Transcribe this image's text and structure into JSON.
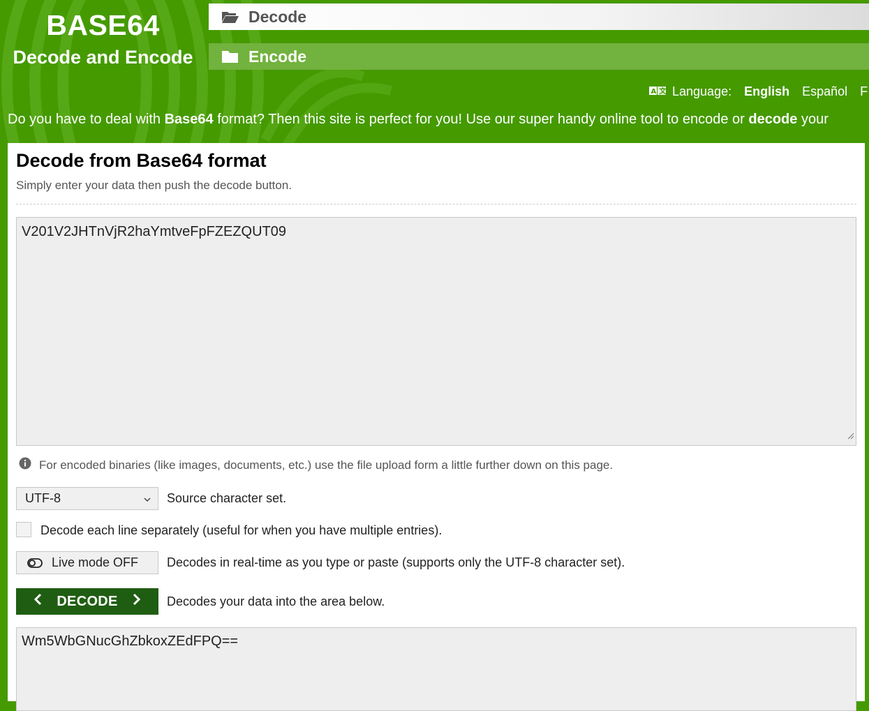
{
  "logo": {
    "title": "BASE64",
    "subtitle": "Decode and Encode"
  },
  "nav": {
    "decode_label": "Decode",
    "encode_label": "Encode"
  },
  "language": {
    "label": "Language:",
    "current": "English",
    "options": [
      "Español",
      "F"
    ]
  },
  "tagline": {
    "part1": "Do you have to deal with ",
    "bold1": "Base64",
    "part2": " format? Then this site is perfect for you! Use our super handy online tool to encode or ",
    "bold2": "decode",
    "part3": " your"
  },
  "main": {
    "title": "Decode from Base64 format",
    "subtitle": "Simply enter your data then push the decode button.",
    "input_value": "V201V2JHTnVjR2haYmtveFpFZEZQUT09",
    "info_text": "For encoded binaries (like images, documents, etc.) use the file upload form a little further down on this page.",
    "charset_value": "UTF-8",
    "charset_label": "Source character set.",
    "line_option_label": "Decode each line separately (useful for when you have multiple entries).",
    "live_mode_label": "Live mode OFF",
    "live_mode_desc": "Decodes in real-time as you type or paste (supports only the UTF-8 character set).",
    "decode_button_label": "DECODE",
    "decode_desc": "Decodes your data into the area below.",
    "output_value": "Wm5WbGNucGhZbkoxZEdFPQ=="
  },
  "colors": {
    "brand_green": "#459a00",
    "nav_encode_bg": "#72b23e",
    "decode_button_bg": "#1f5e12",
    "textarea_bg": "#eeeeee"
  },
  "icons": {
    "decode_nav": "folder-open-icon",
    "encode_nav": "folder-icon",
    "language": "translate-icon",
    "info": "info-icon",
    "select": "chevron-down-icon",
    "live_mode": "toggle-off-icon",
    "decode_prev": "chevron-left-icon",
    "decode_next": "chevron-right-icon"
  }
}
